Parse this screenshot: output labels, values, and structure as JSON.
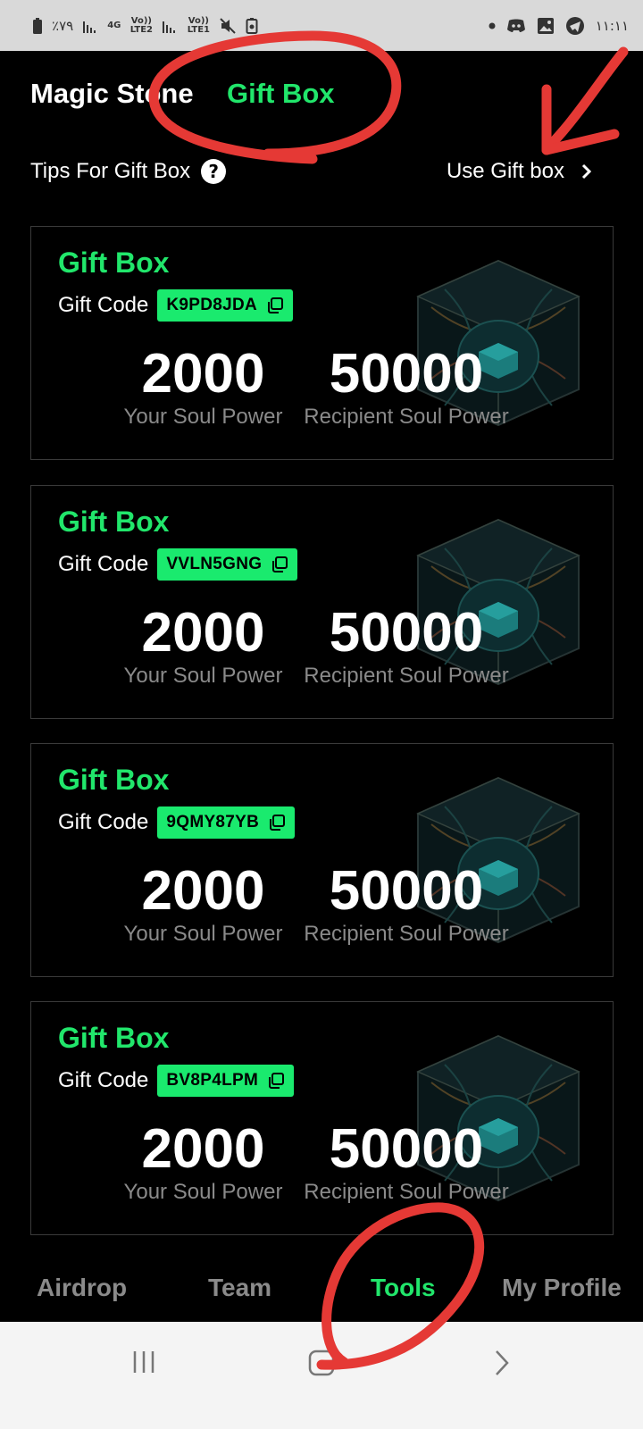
{
  "status_bar": {
    "battery_text": "٪٧٩",
    "net1": "4G",
    "volte1": "Vo)) LTE2",
    "volte2": "Vo)) LTE1",
    "time": "١١:١١"
  },
  "header": {
    "tab_magic": "Magic Stone",
    "tab_gift": "Gift Box"
  },
  "tips": {
    "label": "Tips For Gift Box",
    "help_icon": "question-circle-icon",
    "use_label": "Use Gift box",
    "chevron_icon": "chevron-right-icon"
  },
  "cards": [
    {
      "title": "Gift Box",
      "code_label": "Gift Code",
      "code": "K9PD8JDA",
      "your_value": "2000",
      "your_label": "Your Soul Power",
      "recipient_value": "50000",
      "recipient_label": "Recipient Soul Power"
    },
    {
      "title": "Gift Box",
      "code_label": "Gift Code",
      "code": "VVLN5GNG",
      "your_value": "2000",
      "your_label": "Your Soul Power",
      "recipient_value": "50000",
      "recipient_label": "Recipient Soul Power"
    },
    {
      "title": "Gift Box",
      "code_label": "Gift Code",
      "code": "9QMY87YB",
      "your_value": "2000",
      "your_label": "Your Soul Power",
      "recipient_value": "50000",
      "recipient_label": "Recipient Soul Power"
    },
    {
      "title": "Gift Box",
      "code_label": "Gift Code",
      "code": "BV8P4LPM",
      "your_value": "2000",
      "your_label": "Your Soul Power",
      "recipient_value": "50000",
      "recipient_label": "Recipient Soul Power"
    }
  ],
  "bottom_nav": {
    "airdrop": "Airdrop",
    "team": "Team",
    "tools": "Tools",
    "profile": "My Profile"
  },
  "colors": {
    "accent": "#21e66b",
    "badge": "#1aea6e",
    "muted": "#8a8a8a",
    "annotation": "#e53935"
  }
}
